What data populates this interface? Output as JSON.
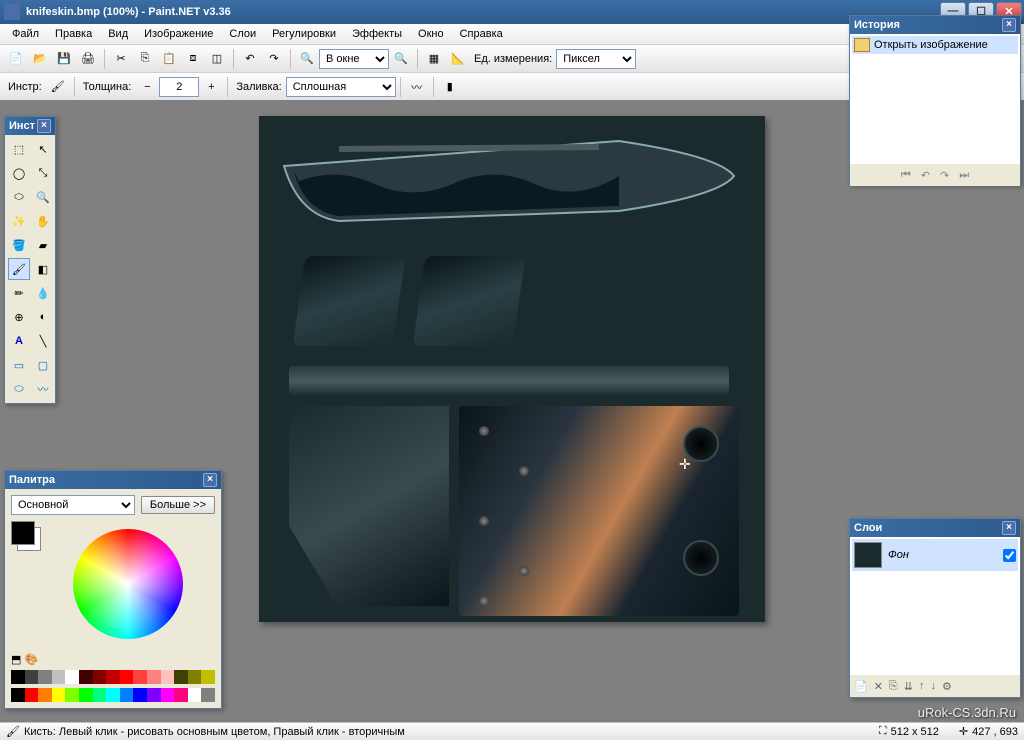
{
  "title": "knifeskin.bmp (100%) - Paint.NET v3.36",
  "menu": [
    "Файл",
    "Правка",
    "Вид",
    "Изображение",
    "Слои",
    "Регулировки",
    "Эффекты",
    "Окно",
    "Справка"
  ],
  "toolbar1": {
    "zoom_label": "В окне",
    "units_label": "Ед. измерения:",
    "units_value": "Пиксел"
  },
  "toolbar2": {
    "tool_label": "Инстр:",
    "thickness_label": "Толщина:",
    "thickness_value": "2",
    "fill_label": "Заливка:",
    "fill_value": "Сплошная"
  },
  "toolbox": {
    "title": "Инст"
  },
  "palette": {
    "title": "Палитра",
    "mode": "Основной",
    "more_btn": "Больше >>"
  },
  "history": {
    "title": "История",
    "item": "Открыть изображение"
  },
  "layers": {
    "title": "Слои",
    "item": "Фон"
  },
  "status": {
    "hint": "Кисть: Левый клик - рисовать основным цветом, Правый клик - вторичным",
    "size": "512 x 512",
    "cursor": "427 , 693"
  },
  "watermark": "uRok-CS.3dn.Ru",
  "colors": {
    "row1": [
      "#000",
      "#404040",
      "#808080",
      "#c0c0c0",
      "#fff",
      "#400000",
      "#800000",
      "#c00000",
      "#ff0000",
      "#ff4040",
      "#ff8080",
      "#ffc0c0",
      "#404000",
      "#808000",
      "#c0c000"
    ],
    "row2": [
      "#000",
      "#ff0000",
      "#ff8000",
      "#ffff00",
      "#80ff00",
      "#00ff00",
      "#00ff80",
      "#00ffff",
      "#0080ff",
      "#0000ff",
      "#8000ff",
      "#ff00ff",
      "#ff0080",
      "#fff",
      "#808080"
    ]
  }
}
